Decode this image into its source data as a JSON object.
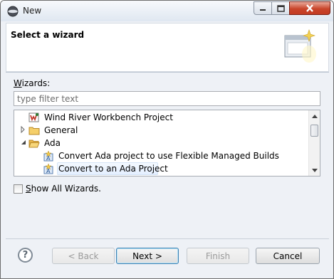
{
  "window": {
    "title": "New",
    "icons": {
      "app": "eclipse-sphere-icon",
      "minimize": "minimize-icon",
      "maximize": "maximize-icon",
      "close": "close-icon"
    }
  },
  "header": {
    "title": "Select a wizard",
    "banner_icon": "wizard-banner-icon"
  },
  "wizards": {
    "label_prefix": "W",
    "label_rest": "izards:",
    "filter_placeholder": "type filter text",
    "tree": [
      {
        "label": "Wind River Workbench Project",
        "icon": "wind-river-project-icon",
        "expander": "",
        "indent": 0
      },
      {
        "label": "General",
        "icon": "folder-icon",
        "expander": "collapsed",
        "indent": 0
      },
      {
        "label": "Ada",
        "icon": "folder-open-icon",
        "expander": "expanded",
        "indent": 0
      },
      {
        "label": "Convert Ada project to use Flexible Managed Builds",
        "icon": "ada-project-icon",
        "expander": "",
        "indent": 1
      },
      {
        "label": "Convert to an Ada Project",
        "icon": "ada-project-icon",
        "expander": "",
        "indent": 1,
        "selected": true
      }
    ],
    "show_all_prefix": "S",
    "show_all_rest": "how All Wizards.",
    "show_all_checked": false
  },
  "buttons": {
    "help_glyph": "?",
    "back": "< Back",
    "next": "Next >",
    "finish": "Finish",
    "cancel": "Cancel"
  },
  "colors": {
    "close_button": "#c9462b",
    "selection": "#e4efff",
    "folder": "#e8b54a"
  }
}
